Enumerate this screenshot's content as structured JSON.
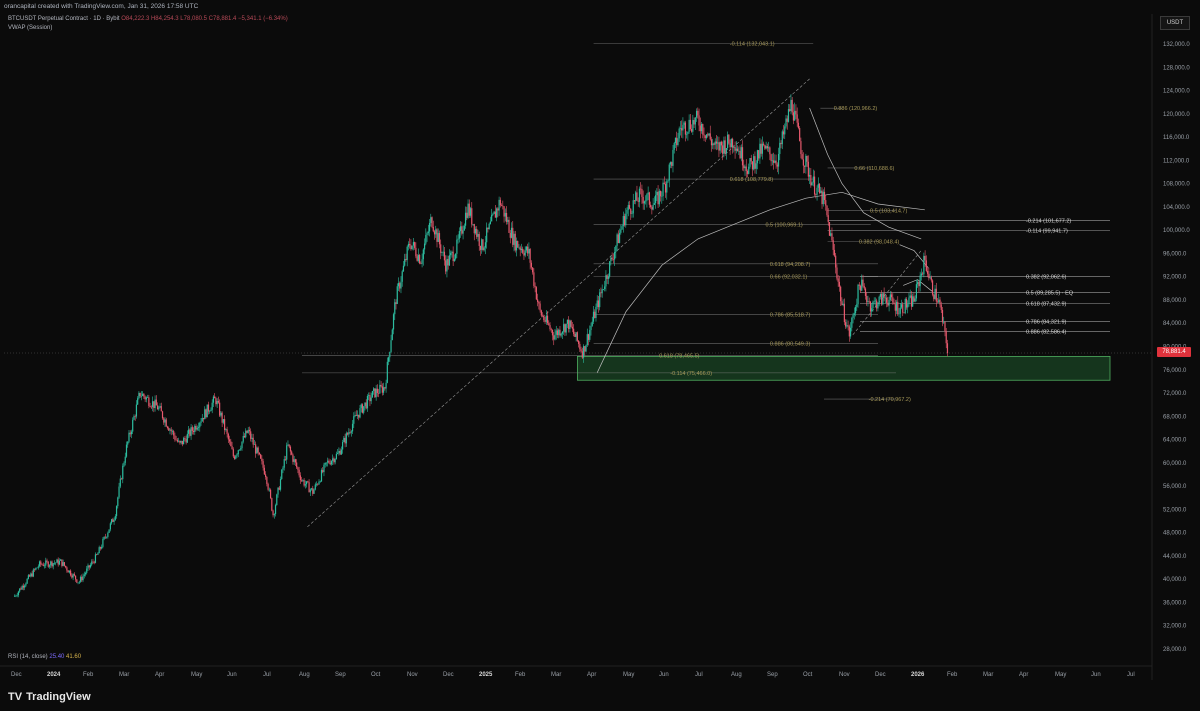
{
  "header": {
    "credit": "orancapital created with TradingView.com, Jan 31, 2026 17:58 UTC",
    "symbol": "BTCUSDT Perpetual Contract · 1D · Bybit",
    "ohlc": "O84,222.3 H84,254.3 L78,080.5 C78,881.4 −5,341.1 (−6.34%)",
    "indicator": "VWAP (Session)"
  },
  "currency_button": "USDT",
  "last_price": "78,881.4",
  "rsi_label": "RSI (14, close)",
  "rsi_values": [
    "25.40",
    "41.60"
  ],
  "footer": {
    "logo": "TV",
    "brand": "TradingView"
  },
  "colors": {
    "background": "#0b0b0b",
    "up": "#2dbda0",
    "down": "#e85a6e",
    "zone": "#1f5a2e",
    "last_price": "#e0323c"
  },
  "chart_data": {
    "type": "candlestick",
    "title": "BTCUSDT Perpetual Contract · 1D · Bybit",
    "ylim": [
      28000,
      134000
    ],
    "y_ticks": [
      "132,000.0",
      "128,000.0",
      "124,000.0",
      "120,000.0",
      "116,000.0",
      "112,000.0",
      "108,000.0",
      "104,000.0",
      "100,000.0",
      "96,000.0",
      "92,000.0",
      "88,000.0",
      "84,000.0",
      "80,000.0",
      "76,000.0",
      "72,000.0",
      "68,000.0",
      "64,000.0",
      "60,000.0",
      "56,000.0",
      "52,000.0",
      "48,000.0",
      "44,000.0",
      "40,000.0",
      "36,000.0",
      "32,000.0",
      "28,000.0"
    ],
    "x_ticks": [
      "Dec",
      "2024",
      "Feb",
      "Mar",
      "Apr",
      "May",
      "Jun",
      "Jul",
      "Aug",
      "Sep",
      "Oct",
      "Nov",
      "Dec",
      "2025",
      "Feb",
      "Mar",
      "Apr",
      "May",
      "Jun",
      "Jul",
      "Aug",
      "Sep",
      "Oct",
      "Nov",
      "Dec",
      "2026",
      "Feb",
      "Mar",
      "Apr",
      "May",
      "Jun",
      "Jul"
    ],
    "price_path": [
      {
        "m": 0.0,
        "p": 37000
      },
      {
        "m": 0.7,
        "p": 42500
      },
      {
        "m": 1.3,
        "p": 43000
      },
      {
        "m": 1.8,
        "p": 39500
      },
      {
        "m": 2.3,
        "p": 44000
      },
      {
        "m": 2.8,
        "p": 51000
      },
      {
        "m": 3.1,
        "p": 62000
      },
      {
        "m": 3.5,
        "p": 72000
      },
      {
        "m": 4.0,
        "p": 69500
      },
      {
        "m": 4.6,
        "p": 63000
      },
      {
        "m": 5.0,
        "p": 66000
      },
      {
        "m": 5.6,
        "p": 71000
      },
      {
        "m": 6.1,
        "p": 61000
      },
      {
        "m": 6.5,
        "p": 65500
      },
      {
        "m": 7.0,
        "p": 58000
      },
      {
        "m": 7.2,
        "p": 51000
      },
      {
        "m": 7.6,
        "p": 63000
      },
      {
        "m": 8.0,
        "p": 57000
      },
      {
        "m": 8.3,
        "p": 55000
      },
      {
        "m": 8.7,
        "p": 60000
      },
      {
        "m": 9.0,
        "p": 61500
      },
      {
        "m": 9.5,
        "p": 68000
      },
      {
        "m": 10.0,
        "p": 72000
      },
      {
        "m": 10.3,
        "p": 73000
      },
      {
        "m": 10.6,
        "p": 88000
      },
      {
        "m": 11.0,
        "p": 98000
      },
      {
        "m": 11.3,
        "p": 95000
      },
      {
        "m": 11.6,
        "p": 102000
      },
      {
        "m": 12.0,
        "p": 94000
      },
      {
        "m": 12.3,
        "p": 97000
      },
      {
        "m": 12.6,
        "p": 104000
      },
      {
        "m": 13.0,
        "p": 97000
      },
      {
        "m": 13.5,
        "p": 105000
      },
      {
        "m": 13.9,
        "p": 98000
      },
      {
        "m": 14.3,
        "p": 96000
      },
      {
        "m": 14.6,
        "p": 86000
      },
      {
        "m": 15.0,
        "p": 82000
      },
      {
        "m": 15.4,
        "p": 84000
      },
      {
        "m": 15.8,
        "p": 79000
      },
      {
        "m": 16.1,
        "p": 85000
      },
      {
        "m": 16.6,
        "p": 95000
      },
      {
        "m": 17.0,
        "p": 103000
      },
      {
        "m": 17.4,
        "p": 106000
      },
      {
        "m": 17.8,
        "p": 104500
      },
      {
        "m": 18.1,
        "p": 108000
      },
      {
        "m": 18.5,
        "p": 117500
      },
      {
        "m": 19.0,
        "p": 119000
      },
      {
        "m": 19.5,
        "p": 114000
      },
      {
        "m": 20.0,
        "p": 115500
      },
      {
        "m": 20.4,
        "p": 110500
      },
      {
        "m": 20.8,
        "p": 114000
      },
      {
        "m": 21.2,
        "p": 112000
      },
      {
        "m": 21.6,
        "p": 122000
      },
      {
        "m": 21.9,
        "p": 113000
      },
      {
        "m": 22.2,
        "p": 108000
      },
      {
        "m": 22.5,
        "p": 105000
      },
      {
        "m": 22.8,
        "p": 95000
      },
      {
        "m": 23.0,
        "p": 87000
      },
      {
        "m": 23.2,
        "p": 82000
      },
      {
        "m": 23.5,
        "p": 91000
      },
      {
        "m": 23.8,
        "p": 87000
      },
      {
        "m": 24.2,
        "p": 88500
      },
      {
        "m": 24.6,
        "p": 86500
      },
      {
        "m": 25.0,
        "p": 88000
      },
      {
        "m": 25.3,
        "p": 95000
      },
      {
        "m": 25.5,
        "p": 90000
      },
      {
        "m": 25.7,
        "p": 87500
      },
      {
        "m": 25.95,
        "p": 78881
      }
    ],
    "fib_levels": [
      {
        "label": "-0.114 (132,043.1)",
        "price": 132043.1
      },
      {
        "label": "0.886 (120,966.2)",
        "price": 120966.2
      },
      {
        "label": "0.66 (110,688.6)",
        "price": 110688.6
      },
      {
        "label": "0.618 (108,779.8)",
        "price": 108779.8
      },
      {
        "label": "0.5 (103,414.7)",
        "price": 103414.7
      },
      {
        "label": "-0.214 (101,677.2)",
        "price": 101677.2
      },
      {
        "label": "0.5 (100,969.1)",
        "price": 100969.1
      },
      {
        "label": "-0.114 (99,941.7)",
        "price": 99941.7
      },
      {
        "label": "0.382 (98,048.4)",
        "price": 98048.4
      },
      {
        "label": "0.618 (94,208.7)",
        "price": 94208.7
      },
      {
        "label": "0.66 (92,032.1)",
        "price": 92032.1
      },
      {
        "label": "0.382 (92,062.6)",
        "price": 92062.6
      },
      {
        "label": "0.5 (89,285.5) · EQ",
        "price": 89285.5
      },
      {
        "label": "0.618 (87,432.9)",
        "price": 87432.9
      },
      {
        "label": "0.786 (85,518.7)",
        "price": 85518.7
      },
      {
        "label": "0.786 (84,321.9)",
        "price": 84321.9
      },
      {
        "label": "0.886 (82,586.4)",
        "price": 82586.4
      },
      {
        "label": "0.886 (80,549.3)",
        "price": 80549.3
      },
      {
        "label": "0.618 (78,465.5)",
        "price": 78465.5
      },
      {
        "label": "-0.114 (75,466.0)",
        "price": 75466.0
      },
      {
        "label": "-0.214 (70,967.2)",
        "price": 70967.2
      }
    ],
    "demand_zone": {
      "from": 74200,
      "to": 78300
    },
    "last_price": 78881.4
  }
}
